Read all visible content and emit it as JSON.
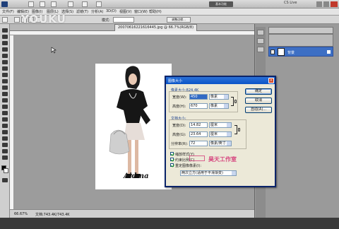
{
  "app": {
    "menus": [
      "文件(F)",
      "编辑(E)",
      "图像(I)",
      "图层(L)",
      "选择(S)",
      "滤镜(T)",
      "分析(A)",
      "3D(D)",
      "视图(V)",
      "窗口(W)",
      "帮助(H)"
    ],
    "workspace_button": "基本功能",
    "cs_live": "CS Live",
    "options": {
      "style_label": "模式:",
      "refine_label": "调整边缘..."
    },
    "document_tab": "20070616221616445.jpg @ 66.7%(RGB/8)",
    "status_zoom": "66.67%",
    "status_doc": "文档:743.4K/743.4K",
    "layer_name": "背景"
  },
  "watermark": "YOUKU",
  "studio_watermark": "昊天工作室",
  "photo_signature": "Aidma",
  "dialog": {
    "title": "图像大小",
    "pixel_dims_label": "像素大小:824.4K",
    "width_label": "宽度(W):",
    "width_value": "450",
    "width_unit": "像素",
    "height_label": "高度(H):",
    "height_value": "670",
    "height_unit": "像素",
    "doc_size_label": "文档大小:",
    "doc_width_label": "宽度(D):",
    "doc_width_value": "14.82",
    "doc_width_unit": "厘米",
    "doc_height_label": "高度(G):",
    "doc_height_value": "23.64",
    "doc_height_unit": "厘米",
    "resolution_label": "分辨率(R):",
    "resolution_value": "72",
    "resolution_unit": "像素/英寸",
    "ok_button": "确定",
    "cancel_button": "取消",
    "auto_button": "自动(A)...",
    "scale_styles": "缩放样式(Y)",
    "constrain_proportions": "约束比例(C)",
    "resample": "重定图像像素(I):",
    "resample_method": "两次立方(适用于平滑渐变)"
  }
}
